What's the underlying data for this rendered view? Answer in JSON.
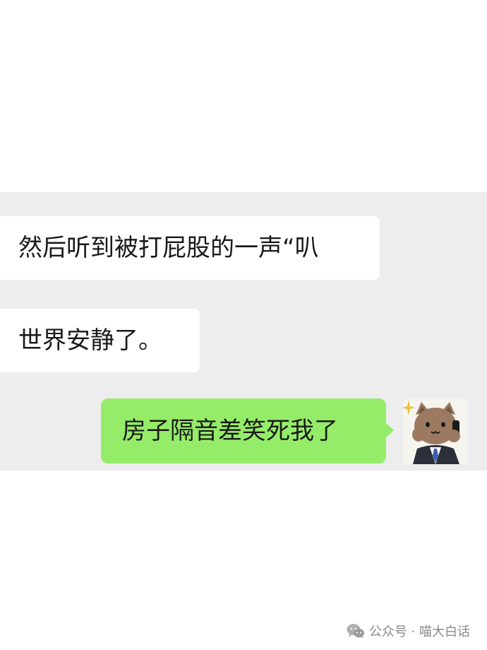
{
  "chat": {
    "messages": [
      {
        "side": "incoming",
        "text": "然后听到被打屁股的一声“叭"
      },
      {
        "side": "incoming",
        "text": "世界安静了。"
      },
      {
        "side": "outgoing",
        "text": "房子隔音差笑死我了"
      }
    ]
  },
  "avatar": {
    "icon": "cat-in-suit-avatar-icon"
  },
  "watermark": {
    "icon": "wechat-icon",
    "text": "公众号 · 喵大白话"
  },
  "colors": {
    "chat_background": "#ededed",
    "incoming_bubble": "#ffffff",
    "outgoing_bubble": "#95ec69",
    "page_background": "#ffffff"
  }
}
